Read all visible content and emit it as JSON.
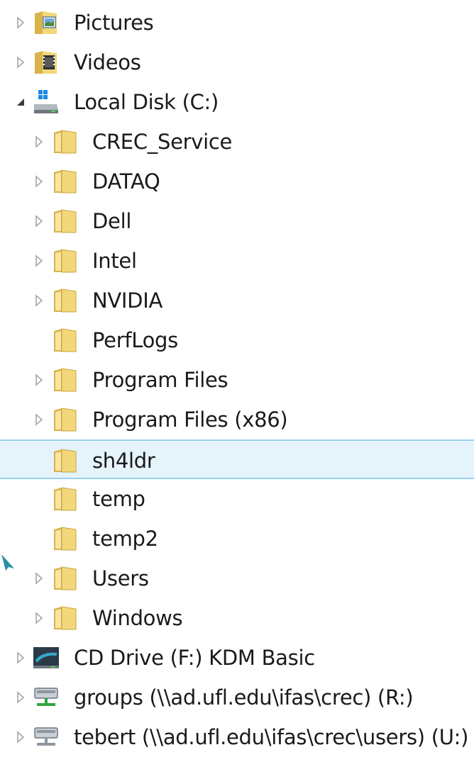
{
  "navigation_tree": {
    "items": [
      {
        "label": "Pictures",
        "level": 0,
        "icon": "pictures-folder-icon",
        "arrow": "collapsed"
      },
      {
        "label": "Videos",
        "level": 0,
        "icon": "videos-folder-icon",
        "arrow": "collapsed"
      },
      {
        "label": "Local Disk (C:)",
        "level": 0,
        "icon": "local-disk-icon",
        "arrow": "expanded"
      },
      {
        "label": "CREC_Service",
        "level": 1,
        "icon": "folder-icon",
        "arrow": "collapsed"
      },
      {
        "label": "DATAQ",
        "level": 1,
        "icon": "folder-icon",
        "arrow": "collapsed"
      },
      {
        "label": "Dell",
        "level": 1,
        "icon": "folder-icon",
        "arrow": "collapsed"
      },
      {
        "label": "Intel",
        "level": 1,
        "icon": "folder-icon",
        "arrow": "collapsed"
      },
      {
        "label": "NVIDIA",
        "level": 1,
        "icon": "folder-icon",
        "arrow": "collapsed"
      },
      {
        "label": "PerfLogs",
        "level": 1,
        "icon": "folder-icon",
        "arrow": "none"
      },
      {
        "label": "Program Files",
        "level": 1,
        "icon": "folder-icon",
        "arrow": "collapsed"
      },
      {
        "label": "Program Files (x86)",
        "level": 1,
        "icon": "folder-icon",
        "arrow": "collapsed"
      },
      {
        "label": "sh4ldr",
        "level": 1,
        "icon": "folder-icon",
        "arrow": "none",
        "selected": true
      },
      {
        "label": "temp",
        "level": 1,
        "icon": "folder-icon",
        "arrow": "none"
      },
      {
        "label": "temp2",
        "level": 1,
        "icon": "folder-icon",
        "arrow": "none"
      },
      {
        "label": "Users",
        "level": 1,
        "icon": "folder-icon",
        "arrow": "collapsed"
      },
      {
        "label": "Windows",
        "level": 1,
        "icon": "folder-icon",
        "arrow": "collapsed"
      },
      {
        "label": "CD Drive (F:) KDM Basic",
        "level": 0,
        "icon": "cd-drive-icon",
        "arrow": "collapsed"
      },
      {
        "label": "groups (\\\\ad.ufl.edu\\ifas\\crec) (R:)",
        "level": 0,
        "icon": "network-drive-icon",
        "arrow": "collapsed"
      },
      {
        "label": "tebert (\\\\ad.ufl.edu\\ifas\\crec\\users) (U:)",
        "level": 0,
        "icon": "disconnected-network-drive-icon",
        "arrow": "collapsed"
      }
    ]
  },
  "colors": {
    "selection_background": "#e5f3fb",
    "selection_border": "#99d1ef",
    "folder_yellow": "#f3d77b",
    "arrow_outline": "#a6a6a6",
    "pointer_teal": "#2b8fa8"
  }
}
